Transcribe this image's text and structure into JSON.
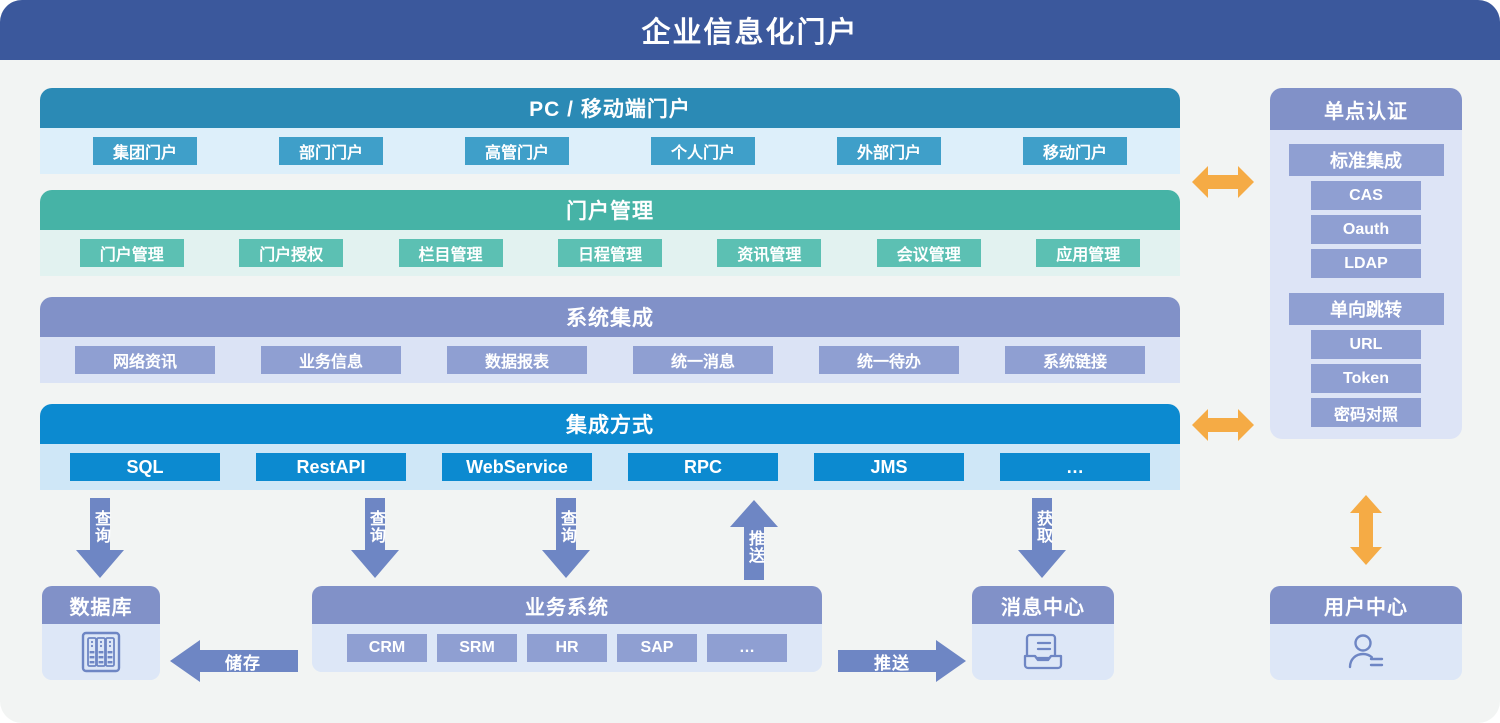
{
  "header": {
    "title": "企业信息化门户"
  },
  "colors": {
    "header_bg": "#3b589c",
    "canvas_bg": "#f2f4f3",
    "portal": "#2b8ab5",
    "manage": "#46b3a6",
    "sysint": "#8191c8",
    "integration": "#0c8ad0",
    "orange_arrow": "#f5ab45",
    "process_arrow": "#6e86c4"
  },
  "bands": [
    {
      "id": "portal",
      "title": "PC / 移动端门户",
      "chips": [
        "集团门户",
        "部门门户",
        "高管门户",
        "个人门户",
        "外部门户",
        "移动门户"
      ]
    },
    {
      "id": "manage",
      "title": "门户管理",
      "chips": [
        "门户管理",
        "门户授权",
        "栏目管理",
        "日程管理",
        "资讯管理",
        "会议管理",
        "应用管理"
      ]
    },
    {
      "id": "sysint",
      "title": "系统集成",
      "chips": [
        "网络资讯",
        "业务信息",
        "数据报表",
        "统一消息",
        "统一待办",
        "系统链接"
      ]
    },
    {
      "id": "integration",
      "title": "集成方式",
      "chips": [
        "SQL",
        "RestAPI",
        "WebService",
        "RPC",
        "JMS",
        "…"
      ]
    }
  ],
  "sso": {
    "title": "单点认证",
    "groups": [
      {
        "label": "标准集成",
        "items": [
          "CAS",
          "Oauth",
          "LDAP"
        ]
      },
      {
        "label": "单向跳转",
        "items": [
          "URL",
          "Token",
          "密码对照"
        ]
      }
    ]
  },
  "arrows": {
    "orange_top": "双向",
    "orange_mid": "双向",
    "orange_user": "双向",
    "query_db": "查询",
    "query_crm": "查询",
    "query_biz": "查询",
    "push_up": "推送",
    "fetch_msg": "获取",
    "store": "储存",
    "push_right": "推送"
  },
  "entities": {
    "database": {
      "title": "数据库",
      "icon": "database-rack-icon"
    },
    "business": {
      "title": "业务系统",
      "chips": [
        "CRM",
        "SRM",
        "HR",
        "SAP",
        "…"
      ]
    },
    "message": {
      "title": "消息中心",
      "icon": "inbox-message-icon"
    },
    "user": {
      "title": "用户中心",
      "icon": "user-profile-icon"
    }
  }
}
